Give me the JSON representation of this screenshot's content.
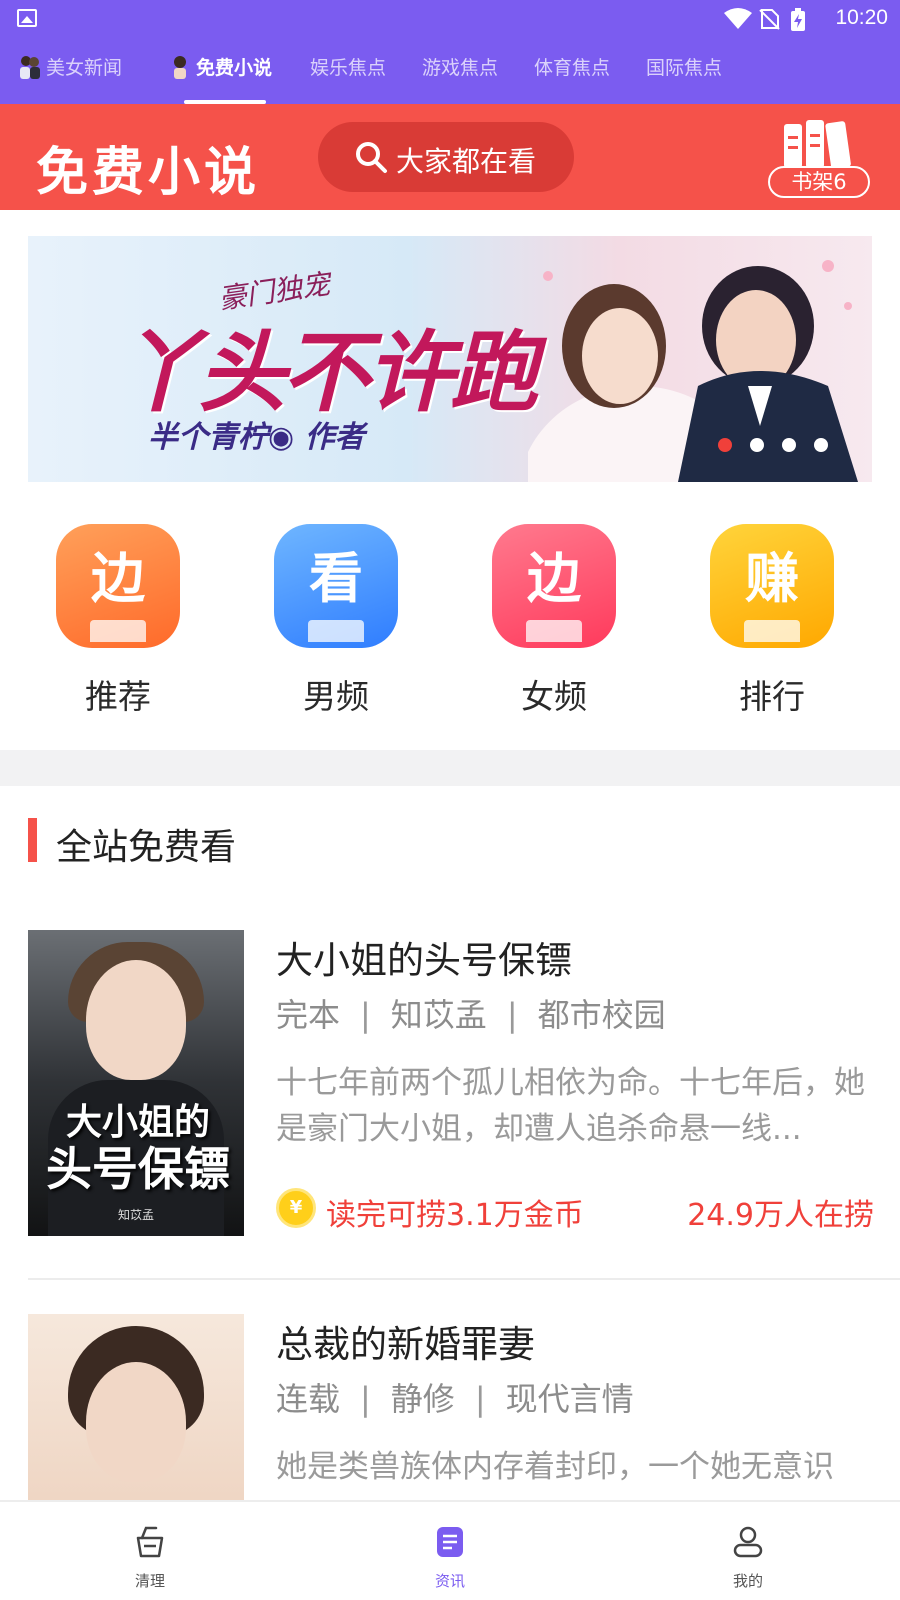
{
  "status_bar": {
    "time": "10:20"
  },
  "category_tabs": [
    {
      "label": "美女新闻",
      "active": false
    },
    {
      "label": "免费小说",
      "active": true
    },
    {
      "label": "娱乐焦点",
      "active": false
    },
    {
      "label": "游戏焦点",
      "active": false
    },
    {
      "label": "体育焦点",
      "active": false
    },
    {
      "label": "国际焦点",
      "active": false
    }
  ],
  "header": {
    "brand": "免费小说",
    "search_label": "大家都在看",
    "bookshelf_label": "书架6"
  },
  "banner": {
    "subtitle": "豪门独宠",
    "title": "丫头不许跑",
    "author_line": "半个青柠◉ 作者",
    "slide_count": 4,
    "active_slide": 0
  },
  "quick_entries": [
    {
      "label": "推荐",
      "glyph": "边",
      "color": "#ff7d3a"
    },
    {
      "label": "男频",
      "glyph": "看",
      "color": "#3f93ff"
    },
    {
      "label": "女频",
      "glyph": "边",
      "color": "#ff4d6d"
    },
    {
      "label": "排行",
      "glyph": "赚",
      "color": "#ffb300"
    }
  ],
  "section": {
    "title": "全站免费看"
  },
  "books": [
    {
      "title": "大小姐的头号保镖",
      "status": "完本",
      "author": "知苡孟",
      "category": "都市校园",
      "description": "十七年前两个孤儿相依为命。十七年后，她是豪门大小姐，却遭人追杀命悬一线...",
      "reward": "读完可捞3.1万金币",
      "readers": "24.9万人在捞",
      "cover_title_line1": "大小姐的",
      "cover_title_line2": "头号保镖",
      "cover_author": "知苡孟"
    },
    {
      "title": "总裁的新婚罪妻",
      "status": "连载",
      "author": "静修",
      "category": "现代言情",
      "description": "她是类兽族体内存着封印，一个她无意识"
    }
  ],
  "bottom_nav": [
    {
      "label": "清理",
      "active": false
    },
    {
      "label": "资讯",
      "active": true
    },
    {
      "label": "我的",
      "active": false
    }
  ],
  "colors": {
    "brand_purple": "#7b5cf0",
    "header_red": "#f5524a",
    "accent_red": "#f0403a"
  }
}
